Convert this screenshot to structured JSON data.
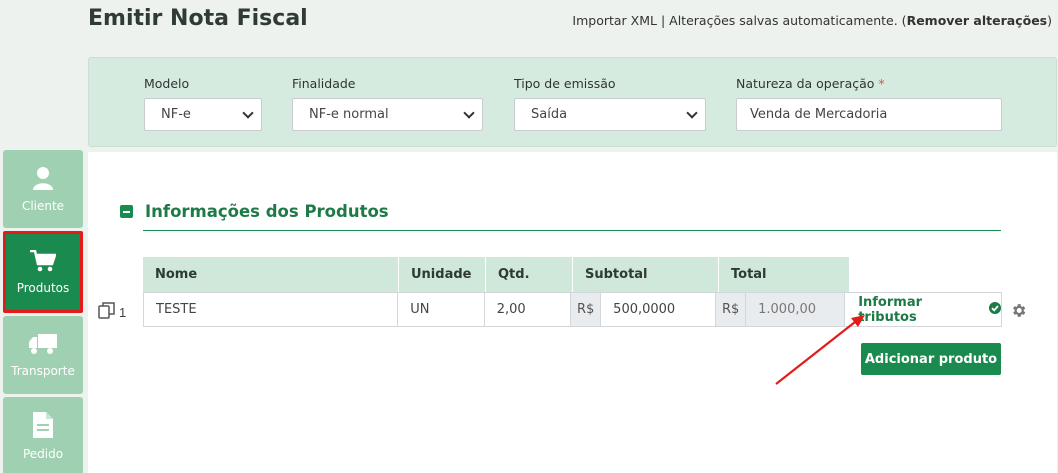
{
  "page": {
    "title": "Emitir Nota Fiscal"
  },
  "top_right": {
    "import_link": "Importar XML",
    "separator": "|",
    "autosave_text": "Alterações salvas automaticamente.",
    "open_paren": "(",
    "remove_link": "Remover alterações",
    "close_paren": ")"
  },
  "filters": {
    "modelo": {
      "label": "Modelo",
      "value": "NF-e"
    },
    "finalidade": {
      "label": "Finalidade",
      "value": "NF-e normal"
    },
    "tipo_emissao": {
      "label": "Tipo de emissão",
      "value": "Saída"
    },
    "natureza": {
      "label": "Natureza da operação",
      "required_mark": "*",
      "value": "Venda de Mercadoria"
    }
  },
  "sidebar": {
    "items": [
      {
        "label": "Cliente",
        "icon": "user-icon",
        "active": false
      },
      {
        "label": "Produtos",
        "icon": "cart-icon",
        "active": true
      },
      {
        "label": "Transporte",
        "icon": "truck-icon",
        "active": false
      },
      {
        "label": "Pedido",
        "icon": "document-icon",
        "active": false
      }
    ]
  },
  "products": {
    "section_title": "Informações dos Produtos",
    "columns": [
      "Nome",
      "Unidade",
      "Qtd.",
      "Subtotal",
      "Total"
    ],
    "rows": [
      {
        "index": "1",
        "nome": "TESTE",
        "unidade": "UN",
        "qtd": "2,00",
        "subtotal_prefix": "R$",
        "subtotal": "500,0000",
        "total_prefix": "R$",
        "total": "1.000,00",
        "tributos_label": "Informar tributos"
      }
    ],
    "add_button": "Adicionar produto"
  },
  "colors": {
    "brand_green": "#1b8a4e",
    "light_green": "#9fd0b2",
    "panel_green": "#d6ebdf",
    "highlight_red": "#e31b1b"
  }
}
